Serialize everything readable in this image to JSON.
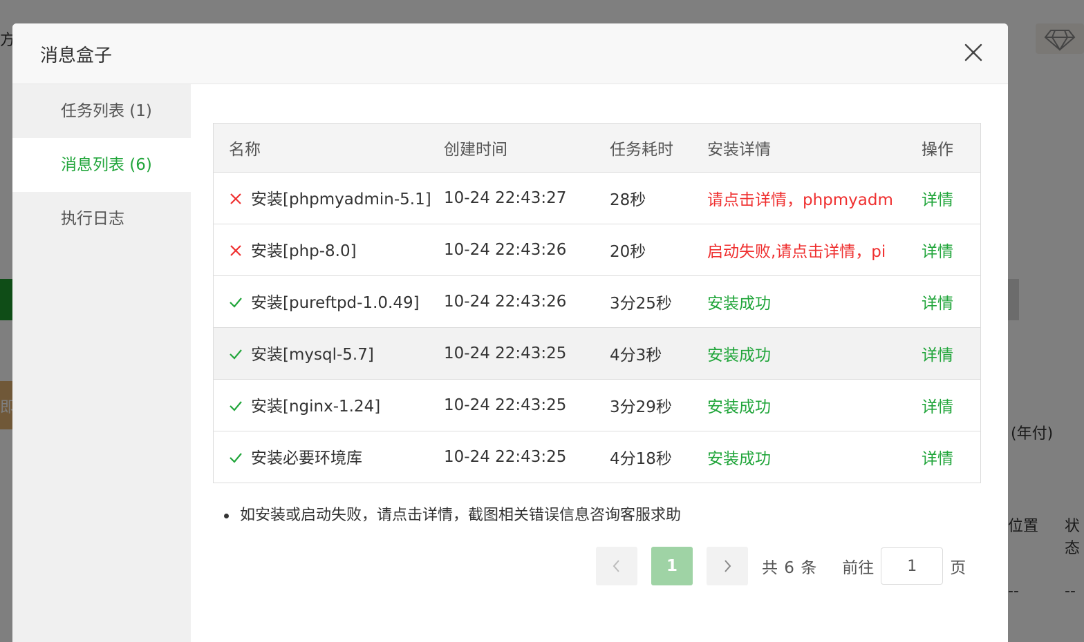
{
  "background": {
    "fragments": [
      "方",
      "即",
      "(年付)",
      "位置",
      "状态",
      "--",
      "--"
    ]
  },
  "modal": {
    "title": "消息盒子",
    "close_icon": "close-icon"
  },
  "sidebar": {
    "items": [
      {
        "label": "任务列表 (1)",
        "active": false
      },
      {
        "label": "消息列表 (6)",
        "active": true
      },
      {
        "label": "执行日志",
        "active": false
      }
    ]
  },
  "table": {
    "headers": [
      "名称",
      "创建时间",
      "任务耗时",
      "安装详情",
      "操作"
    ],
    "rows": [
      {
        "status": "error",
        "name": "安装[phpmyadmin-5.1]",
        "time": "10-24 22:43:27",
        "duration": "28秒",
        "detail": "请点击详情，phpmyadm",
        "action": "详情"
      },
      {
        "status": "error",
        "name": "安装[php-8.0]",
        "time": "10-24 22:43:26",
        "duration": "20秒",
        "detail": "启动失败,请点击详情，pi",
        "action": "详情"
      },
      {
        "status": "success",
        "name": "安装[pureftpd-1.0.49]",
        "time": "10-24 22:43:26",
        "duration": "3分25秒",
        "detail": "安装成功",
        "action": "详情"
      },
      {
        "status": "success",
        "name": "安装[mysql-5.7]",
        "time": "10-24 22:43:25",
        "duration": "4分3秒",
        "detail": "安装成功",
        "action": "详情"
      },
      {
        "status": "success",
        "name": "安装[nginx-1.24]",
        "time": "10-24 22:43:25",
        "duration": "3分29秒",
        "detail": "安装成功",
        "action": "详情"
      },
      {
        "status": "success",
        "name": "安装必要环境库",
        "time": "10-24 22:43:25",
        "duration": "4分18秒",
        "detail": "安装成功",
        "action": "详情"
      }
    ]
  },
  "note": "如安装或启动失败，请点击详情，截图相关错误信息咨询客服求助",
  "pagination": {
    "current_page": "1",
    "total": "共 6 条",
    "goto_label": "前往",
    "goto_value": "1",
    "page_suffix": "页"
  },
  "colors": {
    "accent": "#20a53a",
    "error": "#ef2f2f",
    "active_page_bg": "#9fd3a5"
  }
}
